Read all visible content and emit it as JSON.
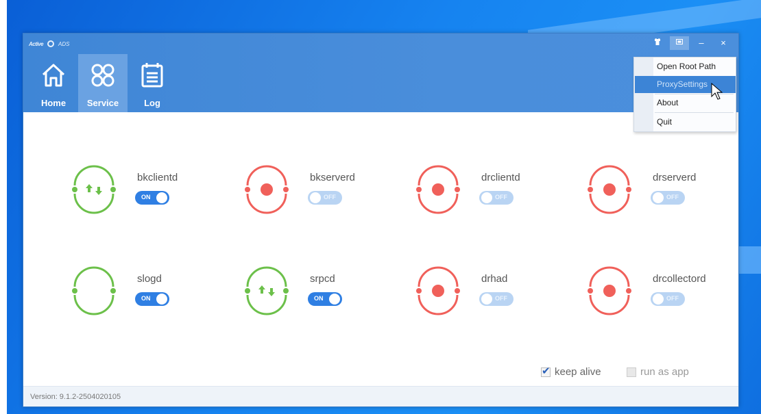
{
  "app": {
    "logo_text": "Active",
    "logo_subtext": "ADS"
  },
  "window_controls": {
    "shirt_icon": "shirt-icon",
    "restore_icon": "maximize-icon",
    "minimize_label": "–",
    "close_label": "×"
  },
  "nav": [
    {
      "label": "Home",
      "icon": "home-icon",
      "active": false
    },
    {
      "label": "Service",
      "icon": "grid-icon",
      "active": true
    },
    {
      "label": "Log",
      "icon": "log-icon",
      "active": false
    }
  ],
  "menu": {
    "items": [
      {
        "label": "Open Root Path"
      },
      {
        "label": "ProxySettings",
        "highlighted": true
      },
      {
        "label": "About"
      },
      {
        "label": "Quit"
      }
    ]
  },
  "services": [
    {
      "name": "bkclientd",
      "state": "ON",
      "status": "running"
    },
    {
      "name": "bkserverd",
      "state": "OFF",
      "status": "stopped"
    },
    {
      "name": "drclientd",
      "state": "OFF",
      "status": "stopped"
    },
    {
      "name": "drserverd",
      "state": "OFF",
      "status": "stopped"
    },
    {
      "name": "slogd",
      "state": "ON",
      "status": "idle"
    },
    {
      "name": "srpcd",
      "state": "ON",
      "status": "running"
    },
    {
      "name": "drhad",
      "state": "OFF",
      "status": "stopped"
    },
    {
      "name": "drcollectord",
      "state": "OFF",
      "status": "stopped"
    }
  ],
  "options": {
    "keep_alive_label": "keep alive",
    "keep_alive_checked": true,
    "run_as_app_label": "run as app",
    "run_as_app_checked": false
  },
  "status": {
    "version": "Version: 9.1.2-2504020105"
  },
  "colors": {
    "accent": "#2f7fe3",
    "running": "#6cc04a",
    "stopped": "#f0605a",
    "titlebar": "#4a8edb"
  }
}
